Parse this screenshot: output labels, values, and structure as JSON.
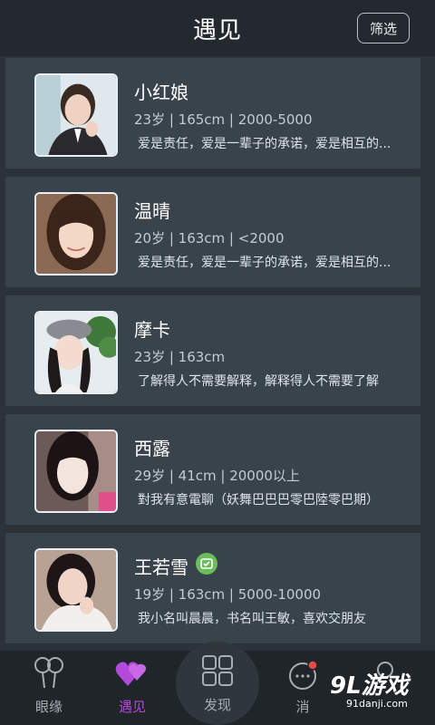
{
  "header": {
    "title": "遇见",
    "filter_label": "筛选"
  },
  "profiles": [
    {
      "name": "小红娘",
      "meta": "23岁 | 165cm | 2000-5000",
      "bio": "爱是责任，爱是一辈子的承诺，爱是相互的..."
    },
    {
      "name": "温晴",
      "meta": "20岁 | 163cm | <2000",
      "bio": "爱是责任，爱是一辈子的承诺，爱是相互的..."
    },
    {
      "name": "摩卡",
      "meta": "23岁 | 163cm",
      "bio": "了解得人不需要解释，解释得人不需要了解"
    },
    {
      "name": "西露",
      "meta": "29岁 | 41cm | 20000以上",
      "bio": "對我有意電聊（妖舞巴巴巴零巴陸零巴期）"
    },
    {
      "name": "王若雪",
      "meta": "19岁 | 163cm | 5000-10000",
      "bio": "我小名叫晨晨，书名叫王敏，喜欢交朋友",
      "badge_icon": "verified-icon"
    }
  ],
  "nav": {
    "items": [
      {
        "label": "眼缘",
        "icon": "balloons-icon"
      },
      {
        "label": "遇见",
        "icon": "hearts-icon",
        "active": true
      },
      {
        "label": "发现",
        "icon": "grid-icon"
      },
      {
        "label": "消",
        "icon": "message-icon"
      }
    ]
  },
  "watermark": {
    "main": "9L游戏",
    "sub": "91danji.com"
  },
  "colors": {
    "accent": "#b44ad9",
    "background": "#2b3238",
    "card": "#38434b",
    "header": "#23292e"
  }
}
